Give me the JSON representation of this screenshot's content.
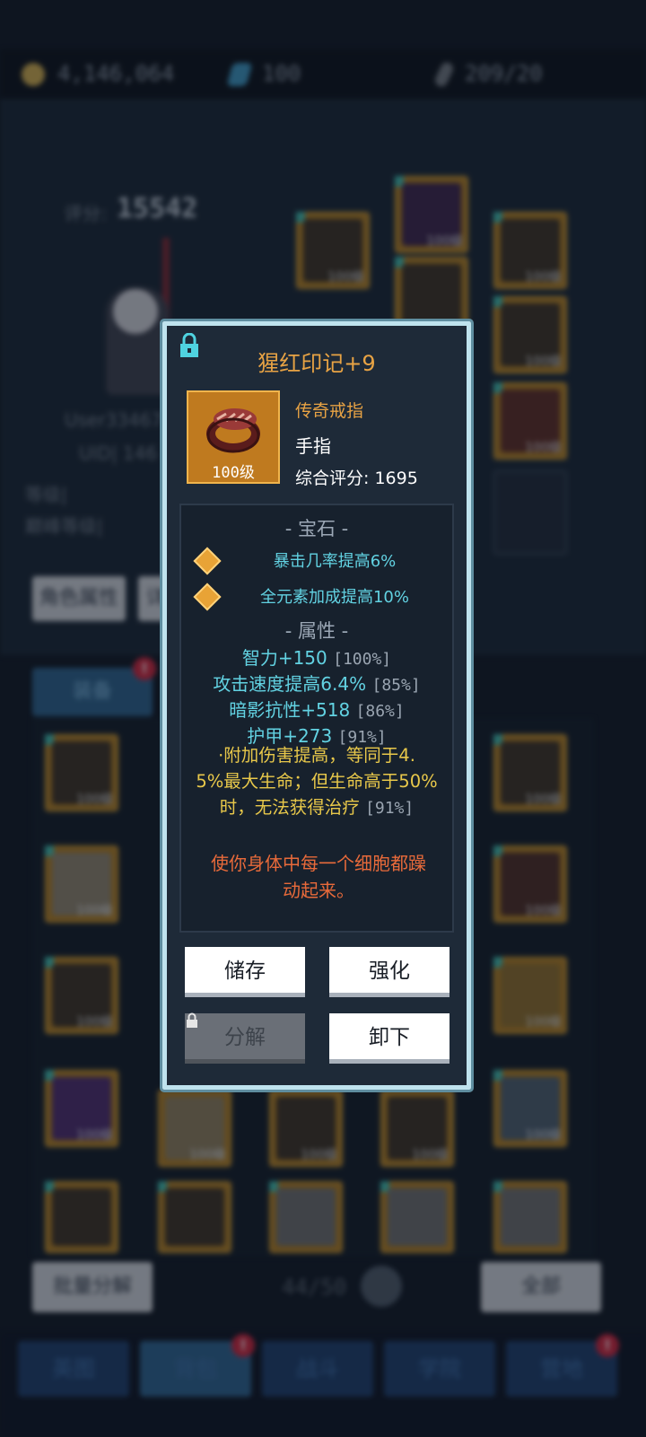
{
  "top_bar": {
    "gold": "4,146,064",
    "gems": "100",
    "feathers": "209/20"
  },
  "character": {
    "score_label": "评分:",
    "score_value": "15542",
    "username": "User33467",
    "uid": "UID| 146",
    "level_label": "等级|",
    "peak_level_label": "巅峰等级|",
    "attr_button": "角色属性",
    "other_button": "详"
  },
  "inventory": {
    "tab_label": "装备",
    "tab_badge": "!",
    "batch_button": "批量分解",
    "page_count": "44/50",
    "filter_button": "全部"
  },
  "slot_level": "100级",
  "bottom_nav": [
    {
      "label": "英图"
    },
    {
      "label": "背包",
      "badge": "!"
    },
    {
      "label": "战斗"
    },
    {
      "label": "学院"
    },
    {
      "label": "营地",
      "badge": "!"
    }
  ],
  "dialog": {
    "title": "猩红印记+9",
    "item_level": "100级",
    "rarity": "传奇戒指",
    "slot": "手指",
    "rating": "综合评分: 1695",
    "gem_section": "- 宝石 -",
    "gems": [
      "暴击几率提高6%",
      "全元素加成提高10%"
    ],
    "attr_section": "- 属性 -",
    "stats": [
      {
        "text": "智力+150",
        "pct": "[100%]"
      },
      {
        "text": "攻击速度提高6.4%",
        "pct": "[85%]"
      },
      {
        "text": "暗影抗性+518",
        "pct": "[86%]"
      },
      {
        "text": "护甲+273",
        "pct": "[91%]"
      }
    ],
    "special": {
      "line1": "·附加伤害提高，等同于4.",
      "line2": "5%最大生命；但生命高于50%",
      "line3": "时，无法获得治疗",
      "pct": "[91%]"
    },
    "flavor_line1": "使你身体中每一个细胞都躁",
    "flavor_line2": "动起来。",
    "buttons": {
      "store": "储存",
      "enhance": "强化",
      "dismantle": "分解",
      "unequip": "卸下"
    },
    "accent_colors": {
      "title": "#e8a344",
      "gem_text": "#62d2e2",
      "special": "#e8c84a",
      "flavor": "#e86a3a"
    }
  }
}
